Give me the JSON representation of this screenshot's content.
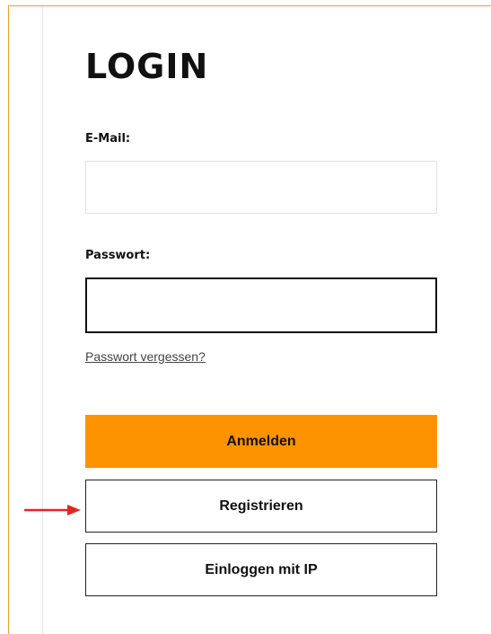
{
  "login_form": {
    "title": "LOGIN",
    "email_label": "E-Mail:",
    "email_value": "",
    "email_placeholder": "",
    "password_label": "Passwort:",
    "password_value": "",
    "password_placeholder": "",
    "forgot_password_link": "Passwort vergessen?",
    "login_button": "Anmelden",
    "register_button": "Registrieren",
    "ip_login_button": "Einloggen mit IP"
  },
  "annotation": {
    "arrow_icon": "right-arrow-icon",
    "arrow_color": "#e8231f",
    "points_to": "register-button"
  },
  "colors": {
    "accent": "#fe9300",
    "frame": "#f39c2b",
    "text": "#111111"
  }
}
